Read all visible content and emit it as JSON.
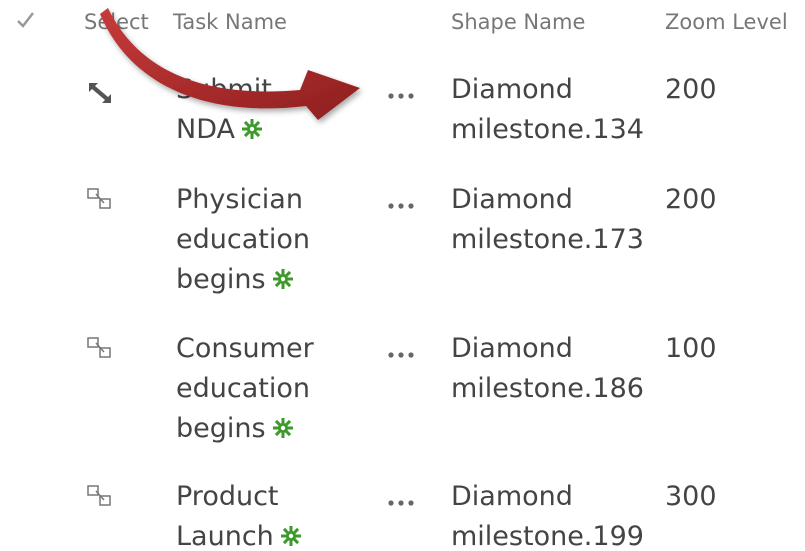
{
  "header": {
    "select_label": "Select",
    "task_name_label": "Task Name",
    "shape_name_label": "Shape Name",
    "zoom_level_label": "Zoom Level"
  },
  "rows": [
    {
      "task_lines": [
        "Submit",
        "NDA"
      ],
      "shape_lines": [
        "Diamond",
        "milestone.134"
      ],
      "zoom": "200",
      "select_icon": "expand-diagonal-icon"
    },
    {
      "task_lines": [
        "Physician",
        "education",
        "begins"
      ],
      "shape_lines": [
        "Diamond",
        "milestone.173"
      ],
      "zoom": "200",
      "select_icon": "select-shape-icon"
    },
    {
      "task_lines": [
        "Consumer",
        "education",
        "begins"
      ],
      "shape_lines": [
        "Diamond",
        "milestone.186"
      ],
      "zoom": "100",
      "select_icon": "select-shape-icon"
    },
    {
      "task_lines": [
        "Product",
        "Launch"
      ],
      "shape_lines": [
        "Diamond",
        "milestone.199"
      ],
      "zoom": "300",
      "select_icon": "select-shape-icon"
    }
  ],
  "colors": {
    "arrow": "#b52a2a",
    "gear": "#3c9a2a",
    "text": "#444444",
    "header_text": "#777777"
  }
}
